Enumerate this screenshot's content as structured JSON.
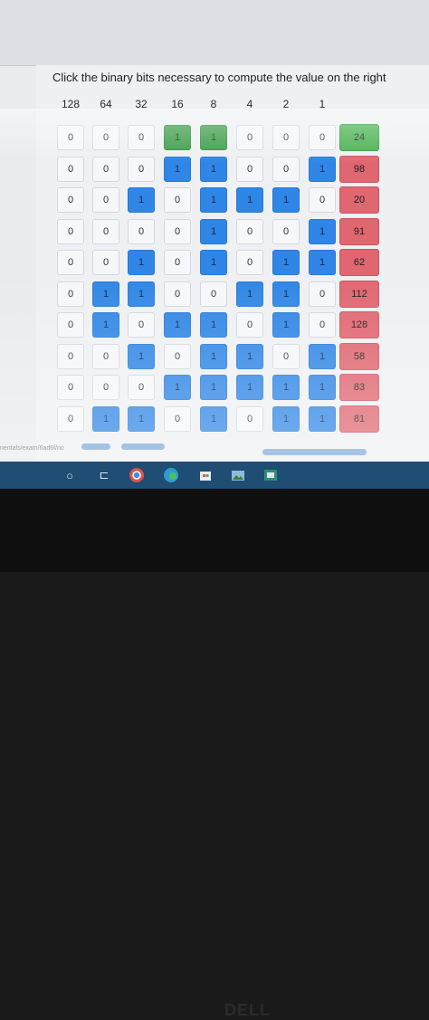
{
  "instruction": "Click the binary bits necessary to compute the value on the right",
  "headers": [
    "128",
    "64",
    "32",
    "16",
    "8",
    "4",
    "2",
    "1"
  ],
  "rows": [
    {
      "bits": [
        "0",
        "0",
        "0",
        "1",
        "1",
        "0",
        "0",
        "0"
      ],
      "state": [
        0,
        0,
        0,
        2,
        2,
        0,
        0,
        0
      ],
      "target": "24",
      "status": "correct"
    },
    {
      "bits": [
        "0",
        "0",
        "0",
        "1",
        "1",
        "0",
        "0",
        "1"
      ],
      "state": [
        0,
        0,
        0,
        1,
        1,
        0,
        0,
        1
      ],
      "target": "98",
      "status": "incorrect"
    },
    {
      "bits": [
        "0",
        "0",
        "1",
        "0",
        "1",
        "1",
        "1",
        "0"
      ],
      "state": [
        0,
        0,
        1,
        0,
        1,
        1,
        1,
        0
      ],
      "target": "20",
      "status": "incorrect"
    },
    {
      "bits": [
        "0",
        "0",
        "0",
        "0",
        "1",
        "0",
        "0",
        "1"
      ],
      "state": [
        0,
        0,
        0,
        0,
        1,
        0,
        0,
        1
      ],
      "target": "91",
      "status": "incorrect"
    },
    {
      "bits": [
        "0",
        "0",
        "1",
        "0",
        "1",
        "0",
        "1",
        "1"
      ],
      "state": [
        0,
        0,
        1,
        0,
        1,
        0,
        1,
        1
      ],
      "target": "62",
      "status": "incorrect"
    },
    {
      "bits": [
        "0",
        "1",
        "1",
        "0",
        "0",
        "1",
        "1",
        "0"
      ],
      "state": [
        0,
        1,
        1,
        0,
        0,
        1,
        1,
        0
      ],
      "target": "112",
      "status": "incorrect"
    },
    {
      "bits": [
        "0",
        "1",
        "0",
        "1",
        "1",
        "0",
        "1",
        "0"
      ],
      "state": [
        0,
        1,
        0,
        1,
        1,
        0,
        1,
        0
      ],
      "target": "128",
      "status": "incorrect"
    },
    {
      "bits": [
        "0",
        "0",
        "1",
        "0",
        "1",
        "1",
        "0",
        "1"
      ],
      "state": [
        0,
        0,
        1,
        0,
        1,
        1,
        0,
        1
      ],
      "target": "58",
      "status": "incorrect"
    },
    {
      "bits": [
        "0",
        "0",
        "0",
        "1",
        "1",
        "1",
        "1",
        "1"
      ],
      "state": [
        0,
        0,
        0,
        1,
        1,
        1,
        1,
        1
      ],
      "target": "83",
      "status": "incorrect"
    },
    {
      "bits": [
        "0",
        "1",
        "1",
        "0",
        "1",
        "0",
        "1",
        "1"
      ],
      "state": [
        0,
        1,
        1,
        0,
        1,
        0,
        1,
        1
      ],
      "target": "81",
      "status": "incorrect"
    }
  ],
  "url_fragment": "nentals/exam/6ad6f/no",
  "taskbar_icons": [
    "start-circle-icon",
    "task-view-icon",
    "chrome-icon",
    "edge-icon",
    "store-icon",
    "photos-icon",
    "app-icon"
  ],
  "brand": "DELL",
  "colors": {
    "on_blue": "#2f86e6",
    "on_green": "#3a9b46",
    "target_red": "#e06670",
    "target_green": "#46b04f"
  }
}
